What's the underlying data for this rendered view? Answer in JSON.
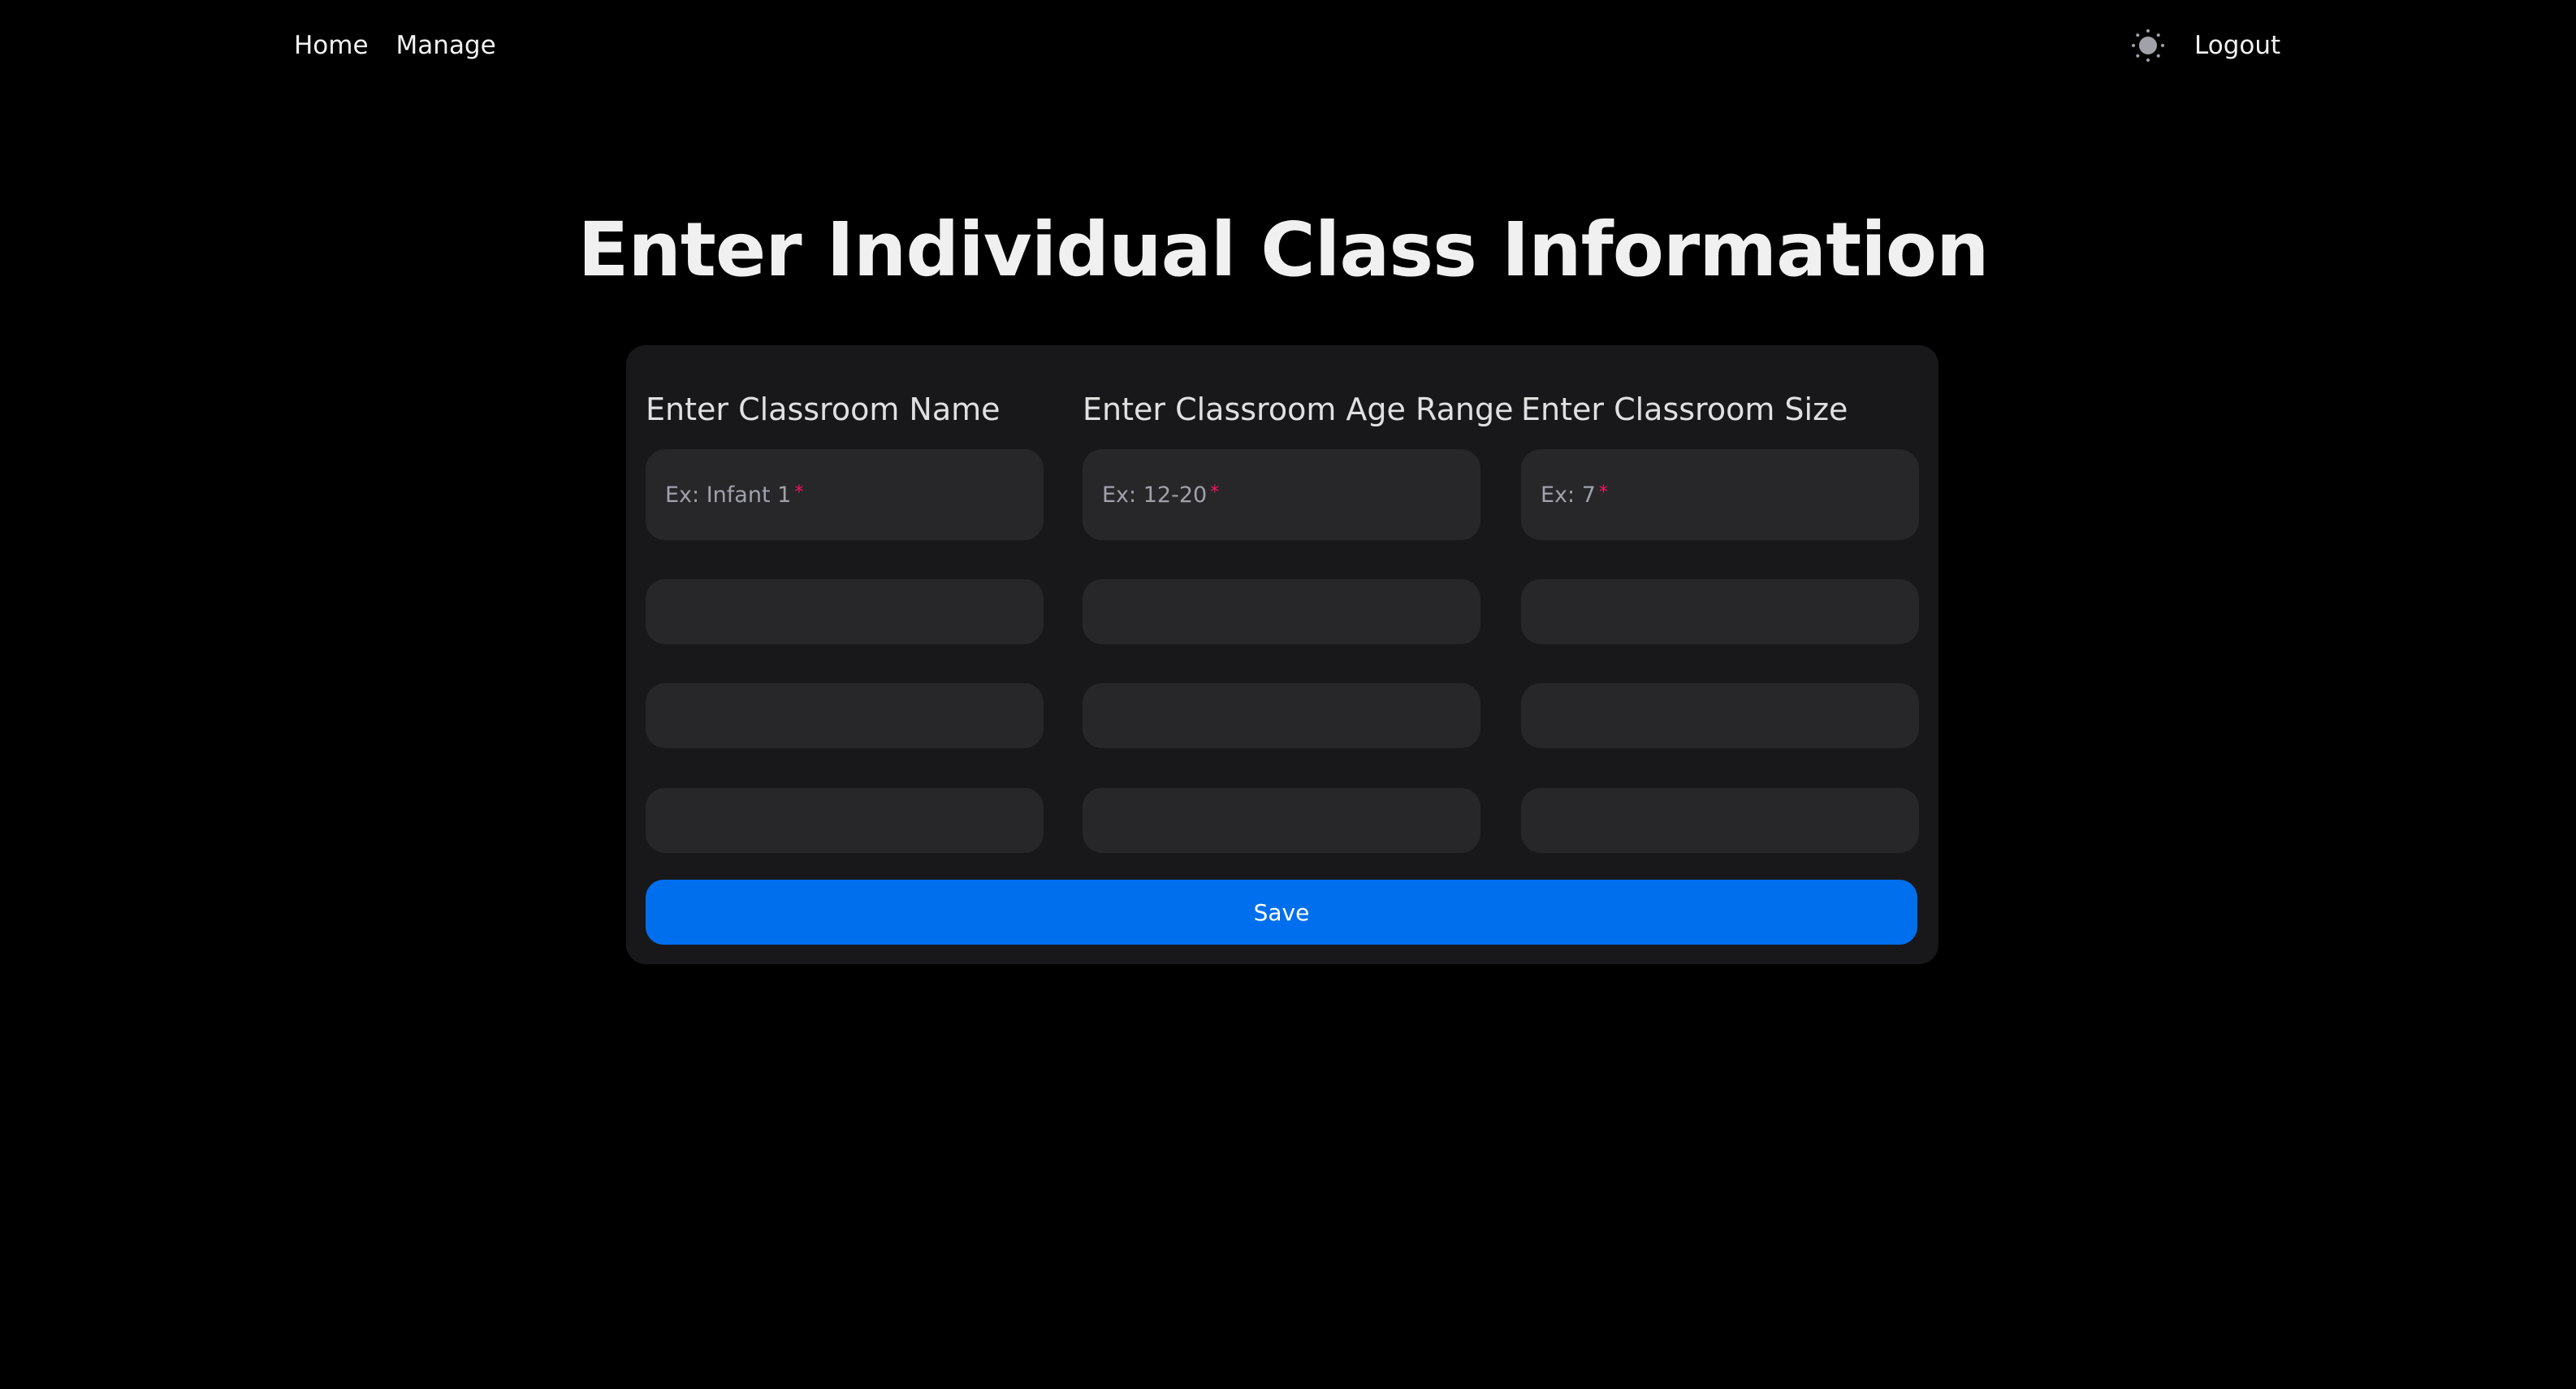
{
  "nav": {
    "links": [
      {
        "label": "Home"
      },
      {
        "label": "Manage"
      }
    ],
    "theme_icon": "sun-icon",
    "logout_label": "Logout"
  },
  "page": {
    "title": "Enter Individual Class Information"
  },
  "form": {
    "columns": [
      {
        "header": "Enter Classroom Name",
        "placeholder": "Ex: Infant 1",
        "required_mark": "*"
      },
      {
        "header": "Enter Classroom Age Range",
        "placeholder": "Ex: 12-20",
        "required_mark": "*"
      },
      {
        "header": "Enter Classroom Size",
        "placeholder": "Ex: 7",
        "required_mark": "*"
      }
    ],
    "save_label": "Save"
  },
  "colors": {
    "background": "#000000",
    "card": "#18181b",
    "input": "#27272a",
    "primary": "#006fee",
    "required": "#f31260"
  }
}
